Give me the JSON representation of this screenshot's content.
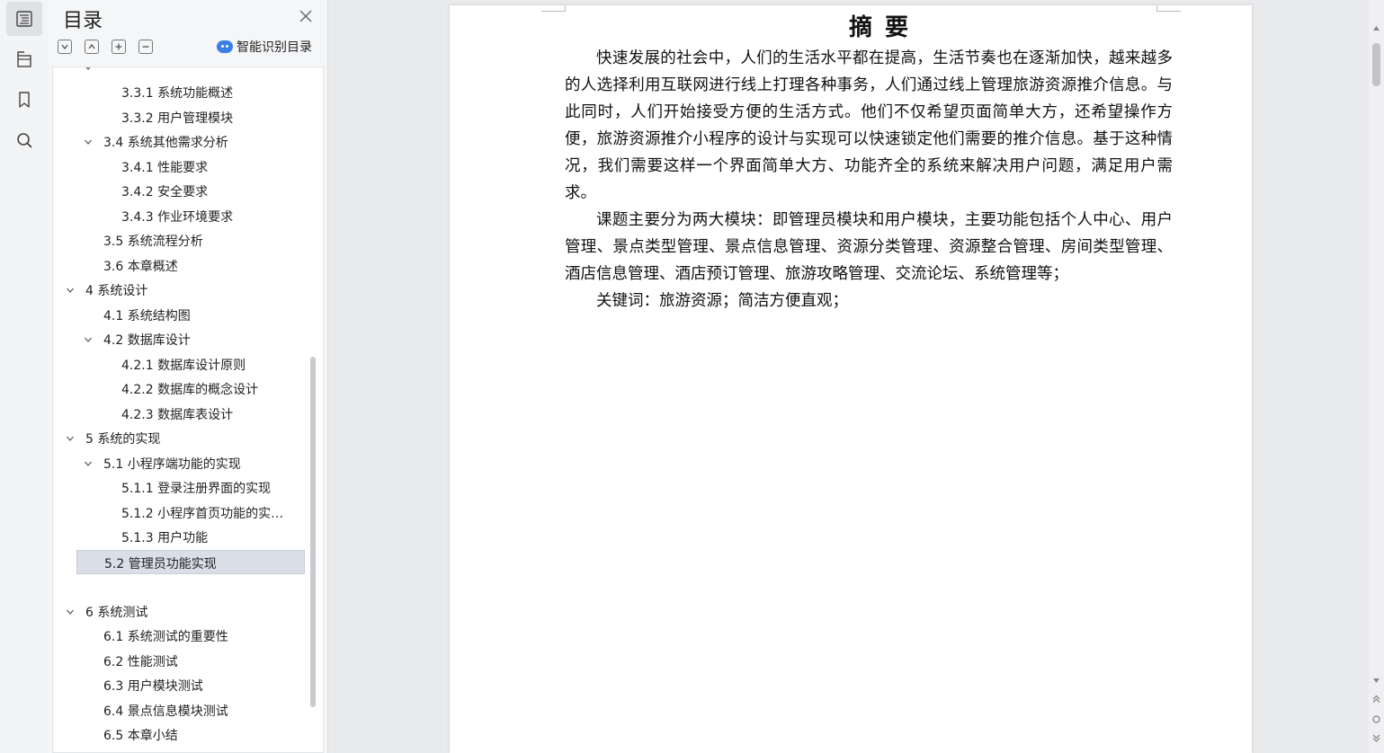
{
  "toc": {
    "title": "目录",
    "smart_label": "智能识别目录",
    "items": [
      {
        "label": "3.3.1 系统功能概述",
        "level": 3,
        "chevron": false,
        "selected": false
      },
      {
        "label": "3.3.2 用户管理模块",
        "level": 3,
        "chevron": false,
        "selected": false
      },
      {
        "label": "3.4 系统其他需求分析",
        "level": 2,
        "chevron": true,
        "selected": false
      },
      {
        "label": "3.4.1 性能要求",
        "level": 3,
        "chevron": false,
        "selected": false
      },
      {
        "label": "3.4.2 安全要求",
        "level": 3,
        "chevron": false,
        "selected": false
      },
      {
        "label": "3.4.3 作业环境要求",
        "level": 3,
        "chevron": false,
        "selected": false
      },
      {
        "label": "3.5 系统流程分析",
        "level": 2,
        "chevron": false,
        "selected": false
      },
      {
        "label": "3.6 本章概述",
        "level": 2,
        "chevron": false,
        "selected": false
      },
      {
        "label": "4  系统设计",
        "level": 1,
        "chevron": true,
        "selected": false
      },
      {
        "label": "4.1 系统结构图",
        "level": 2,
        "chevron": false,
        "selected": false
      },
      {
        "label": "4.2 数据库设计",
        "level": 2,
        "chevron": true,
        "selected": false
      },
      {
        "label": "4.2.1 数据库设计原则",
        "level": 3,
        "chevron": false,
        "selected": false
      },
      {
        "label": "4.2.2 数据库的概念设计",
        "level": 3,
        "chevron": false,
        "selected": false
      },
      {
        "label": "4.2.3 数据库表设计",
        "level": 3,
        "chevron": false,
        "selected": false
      },
      {
        "label": "5 系统的实现",
        "level": 1,
        "chevron": true,
        "selected": false
      },
      {
        "label": "5.1 小程序端功能的实现",
        "level": 2,
        "chevron": true,
        "selected": false
      },
      {
        "label": "5.1.1 登录注册界面的实现",
        "level": 3,
        "chevron": false,
        "selected": false
      },
      {
        "label": "5.1.2 小程序首页功能的实…",
        "level": 3,
        "chevron": false,
        "selected": false
      },
      {
        "label": "5.1.3 用户功能",
        "level": 3,
        "chevron": false,
        "selected": false
      },
      {
        "label": "5.2 管理员功能实现",
        "level": 2,
        "chevron": false,
        "selected": true
      },
      {
        "label": "",
        "level": 2,
        "chevron": false,
        "selected": false
      },
      {
        "label": "6 系统测试",
        "level": 1,
        "chevron": true,
        "selected": false
      },
      {
        "label": "6.1 系统测试的重要性",
        "level": 2,
        "chevron": false,
        "selected": false
      },
      {
        "label": "6.2 性能测试",
        "level": 2,
        "chevron": false,
        "selected": false
      },
      {
        "label": "6.3 用户模块测试",
        "level": 2,
        "chevron": false,
        "selected": false
      },
      {
        "label": "6.4 景点信息模块测试",
        "level": 2,
        "chevron": false,
        "selected": false
      },
      {
        "label": "6.5 本章小结",
        "level": 2,
        "chevron": false,
        "selected": false
      }
    ]
  },
  "document": {
    "title": "摘要",
    "paragraphs": [
      "快速发展的社会中，人们的生活水平都在提高，生活节奏也在逐渐加快，越来越多的人选择利用互联网进行线上打理各种事务，人们通过线上管理旅游资源推介信息。与此同时，人们开始接受方便的生活方式。他们不仅希望页面简单大方，还希望操作方便，旅游资源推介小程序的设计与实现可以快速锁定他们需要的推介信息。基于这种情况，我们需要这样一个界面简单大方、功能齐全的系统来解决用户问题，满足用户需求。",
      "课题主要分为两大模块：即管理员模块和用户模块，主要功能包括个人中心、用户管理、景点类型管理、景点信息管理、资源分类管理、资源整合管理、房间类型管理、酒店信息管理、酒店预订管理、旅游攻略管理、交流论坛、系统管理等；",
      "关键词：旅游资源；简洁方便直观；"
    ]
  },
  "colors": {
    "accent": "#3b7fe6",
    "selected_row": "#d9dee7",
    "panel_bg": "#f5f6f8"
  }
}
